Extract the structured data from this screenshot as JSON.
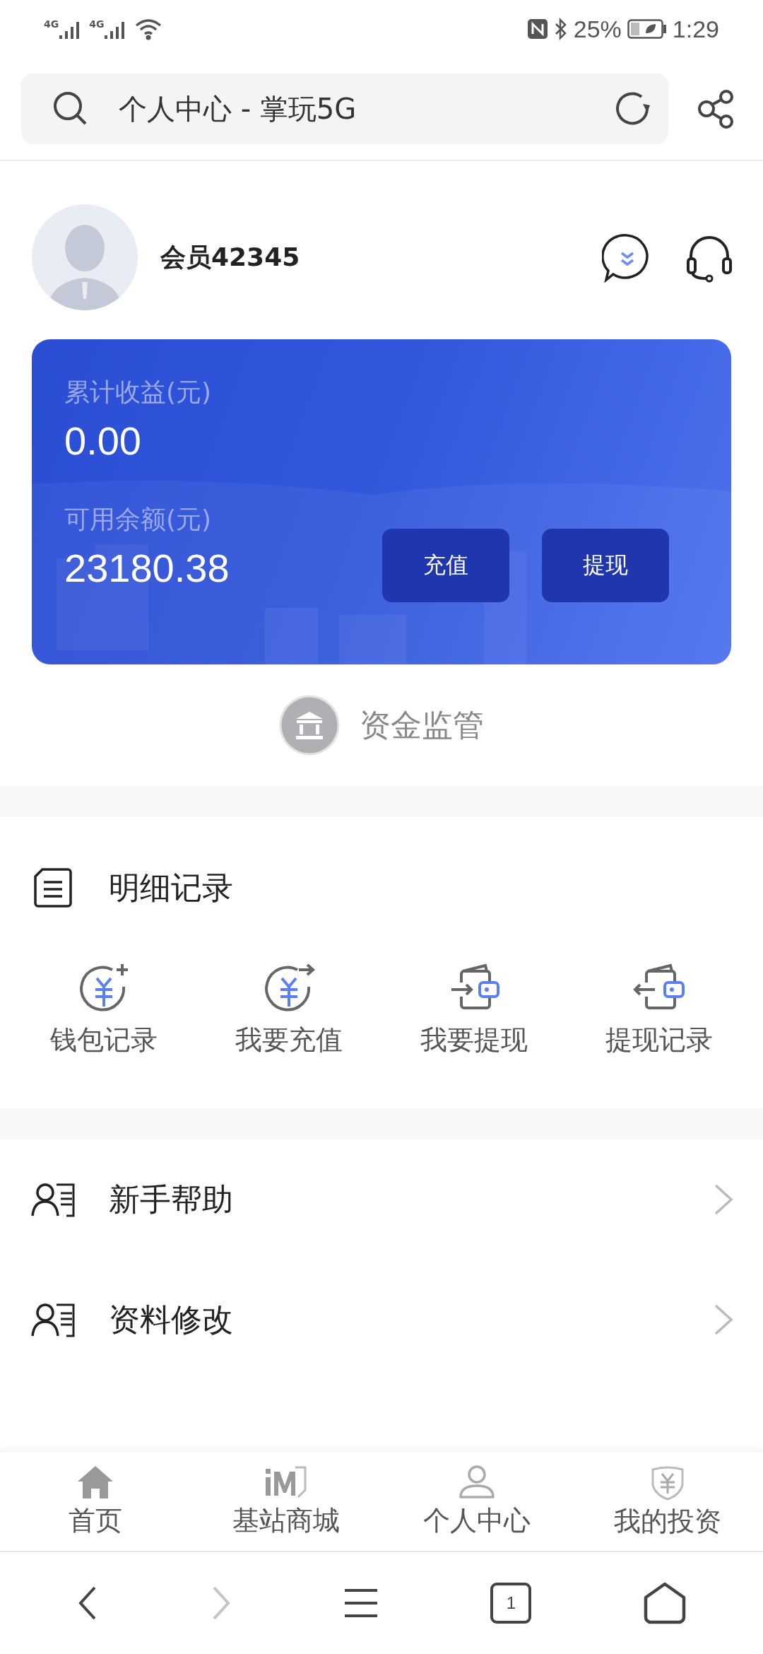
{
  "status_bar": {
    "signals": [
      "4G",
      "4G"
    ],
    "battery": "25%",
    "time": "1:29"
  },
  "address_bar": {
    "title": "个人中心 - 掌玩5G"
  },
  "profile": {
    "name": "会员42345"
  },
  "balance_card": {
    "earnings_label": "累计收益(元)",
    "earnings": "0.00",
    "balance_label": "可用余额(元)",
    "balance": "23180.38",
    "buttons": [
      "充值",
      "提现"
    ]
  },
  "fund_supervision": "资金监管",
  "records": {
    "title": "明细记录",
    "items": [
      {
        "kind": "coin-plus",
        "label": "钱包记录"
      },
      {
        "kind": "coin-arrow",
        "label": "我要充值"
      },
      {
        "kind": "wallet-in",
        "label": "我要提现"
      },
      {
        "kind": "wallet-out",
        "label": "提现记录"
      }
    ]
  },
  "menu": [
    {
      "label": "新手帮助"
    },
    {
      "label": "资料修改"
    }
  ],
  "tab_bar": [
    {
      "kind": "home",
      "label": "首页"
    },
    {
      "kind": "store",
      "label": "基站商城"
    },
    {
      "kind": "person",
      "label": "个人中心"
    },
    {
      "kind": "invest",
      "label": "我的投资"
    }
  ],
  "browser_toolbar": [
    {
      "kind": "back",
      "disabled": false
    },
    {
      "kind": "forward",
      "disabled": true
    },
    {
      "kind": "menu",
      "disabled": false
    },
    {
      "kind": "tabs",
      "count": "1",
      "disabled": false
    },
    {
      "kind": "home",
      "disabled": false
    }
  ]
}
